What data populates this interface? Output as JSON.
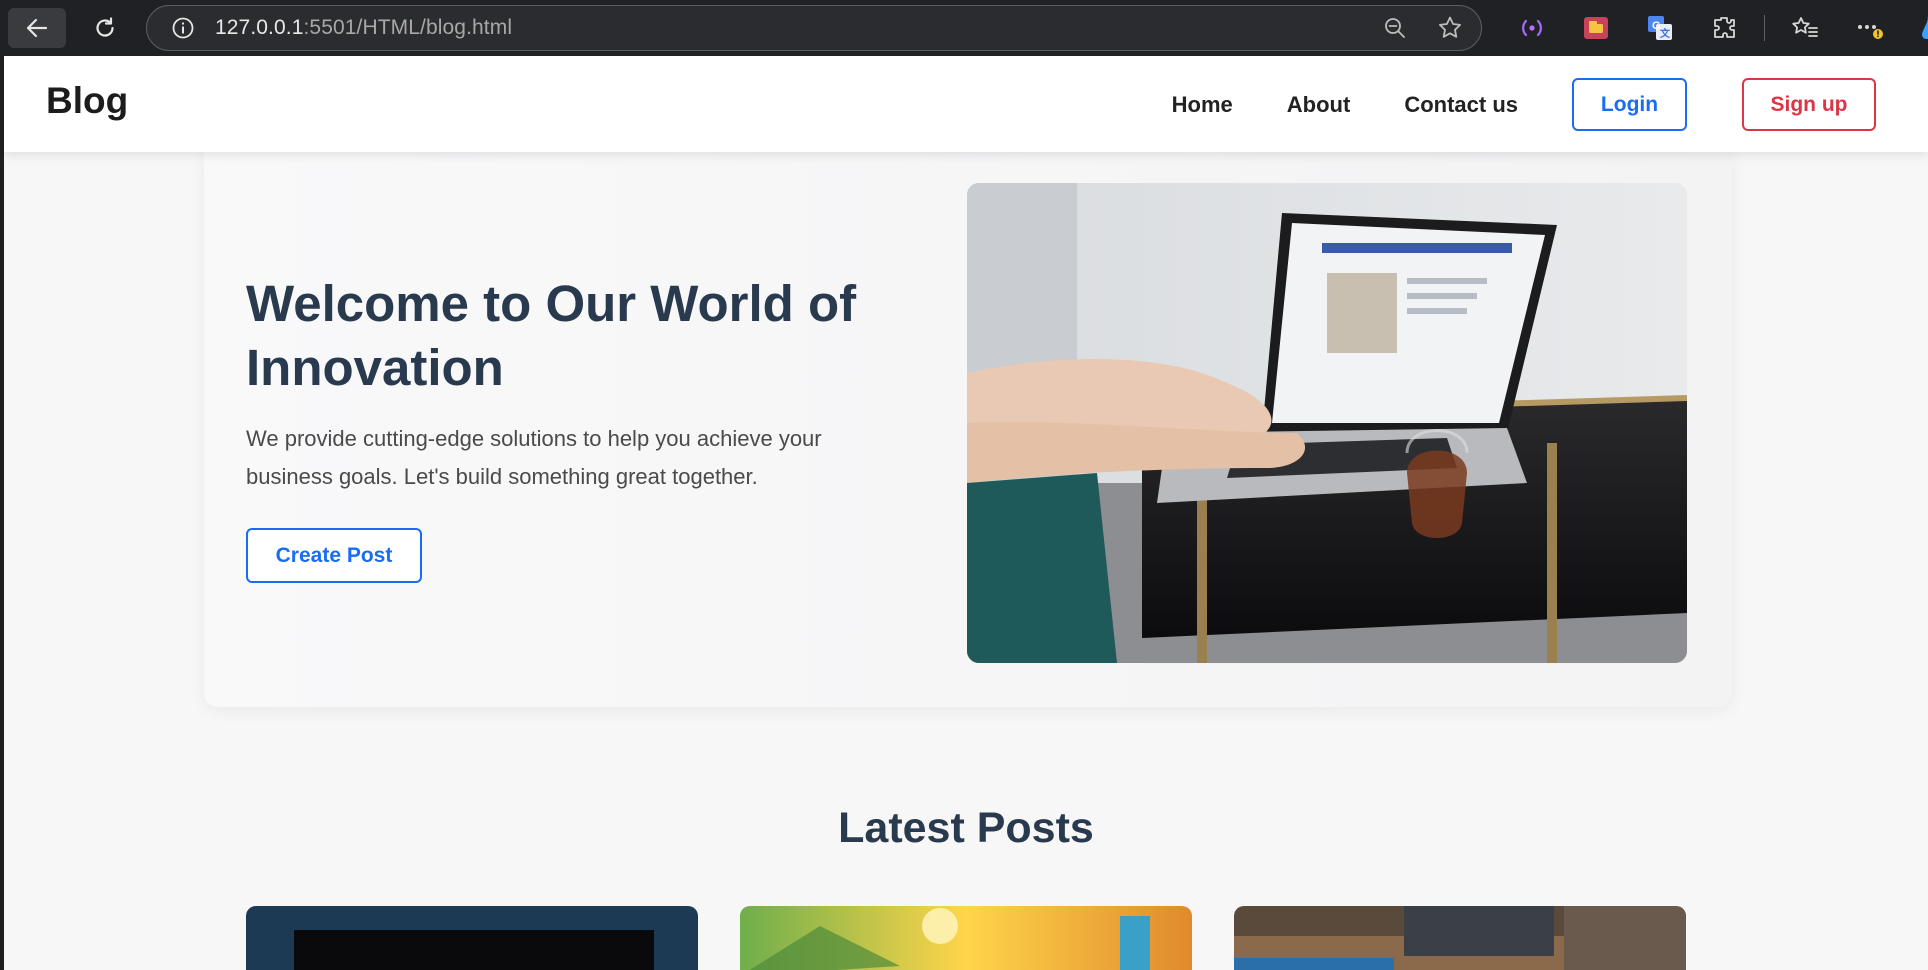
{
  "browser": {
    "url_host": "127.0.0.1",
    "url_rest": ":5501/HTML/blog.html"
  },
  "site": {
    "logo": "Blog",
    "nav": [
      "Home",
      "About",
      "Contact us"
    ],
    "login_label": "Login",
    "signup_label": "Sign up"
  },
  "hero": {
    "title": "Welcome to Our World of Innovation",
    "text": "We provide cutting-edge solutions to help you achieve your business goals. Let's build something great together.",
    "cta_label": "Create Post"
  },
  "posts": {
    "title": "Latest Posts"
  },
  "colors": {
    "primary": "#1a6df3",
    "danger": "#dc3545",
    "heading": "#2a3a4e"
  }
}
